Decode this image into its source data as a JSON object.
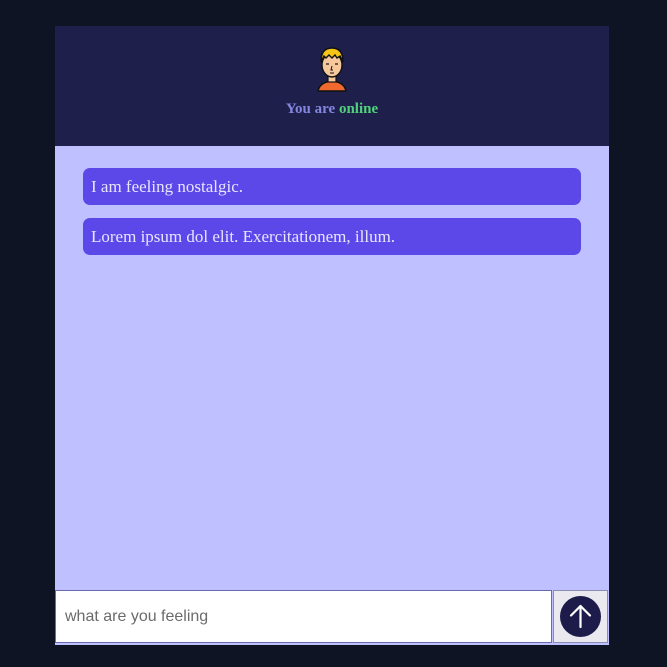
{
  "header": {
    "status_prefix": "You are",
    "status_value": "online",
    "avatar_icon": "user-avatar-icon"
  },
  "messages": [
    {
      "text": "I am feeling nostalgic."
    },
    {
      "text": "Lorem ipsum dol elit. Exercitationem, illum."
    }
  ],
  "composer": {
    "placeholder": "what are you feeling",
    "value": "",
    "send_icon": "arrow-up-icon"
  },
  "colors": {
    "page_bg": "#0f1424",
    "header_bg": "#1e1f4b",
    "chat_bg": "#bfc0ff",
    "bubble_bg": "#5c48e8",
    "status_text": "#8486e0",
    "online": "#4fd37a",
    "send_button": "#1c1b4a"
  }
}
